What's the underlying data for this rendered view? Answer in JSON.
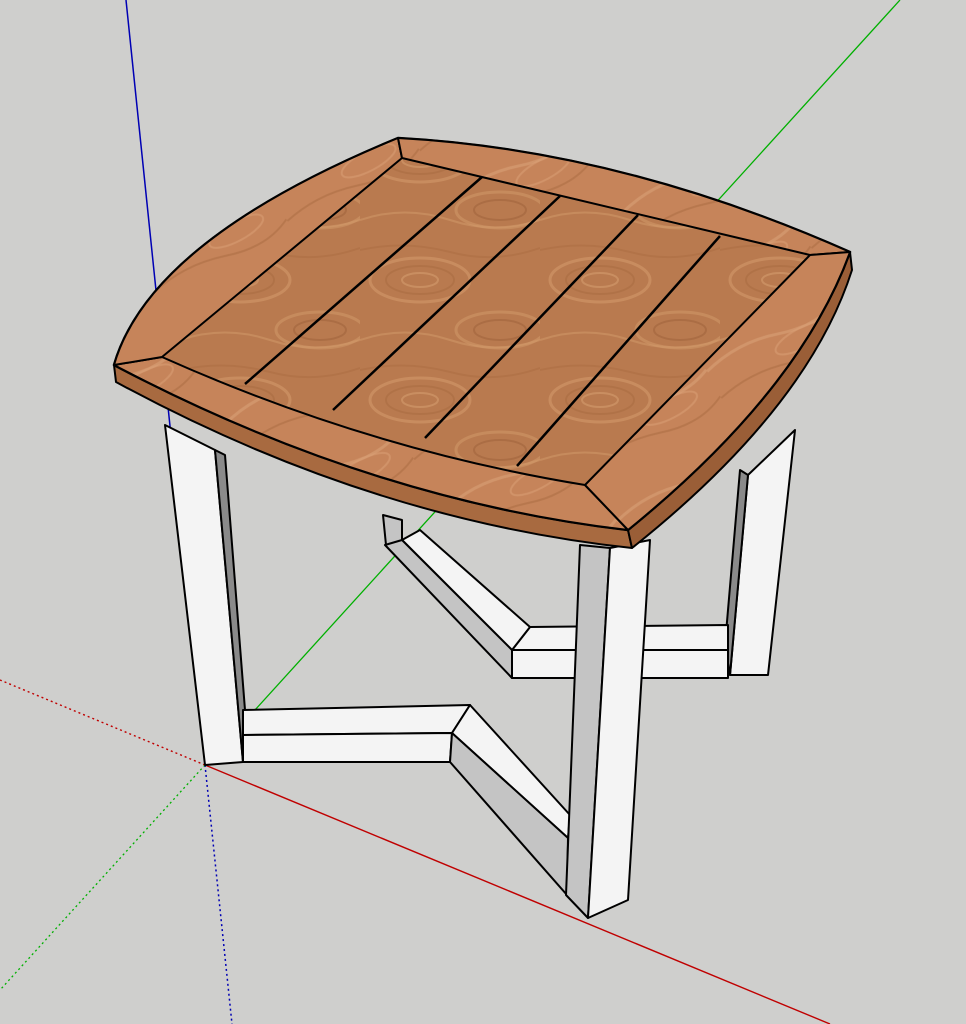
{
  "viewport": {
    "background_color": "#cfcfcd"
  },
  "axes": {
    "red_axis_color": "#c00000",
    "green_axis_color": "#00b000",
    "blue_axis_color": "#0000b4"
  },
  "model": {
    "tabletop_wood_base_color": "#b97a4f",
    "tabletop_wood_light_color": "#d49b6c",
    "tabletop_wood_dark_color": "#9a5e37",
    "tabletop_edge_color": "#c6845a",
    "leg_front_color": "#f4f4f4",
    "leg_side_color": "#c4c4c4",
    "leg_dark_color": "#8a8a8a",
    "edge_line_color": "#000000"
  }
}
